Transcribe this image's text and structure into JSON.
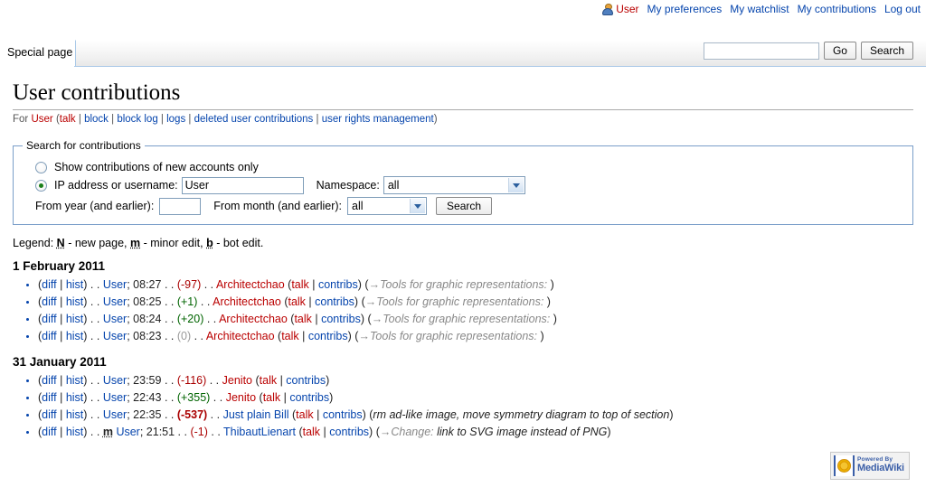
{
  "personal_bar": {
    "user_icon": "user-avatar-icon",
    "items": [
      {
        "label": "User",
        "style": "red"
      },
      {
        "label": "My preferences",
        "style": "blue"
      },
      {
        "label": "My watchlist",
        "style": "blue"
      },
      {
        "label": "My contributions",
        "style": "blue"
      },
      {
        "label": "Log out",
        "style": "blue"
      }
    ]
  },
  "tabs": {
    "special_page": "Special page"
  },
  "top_search": {
    "value": "",
    "go_label": "Go",
    "search_label": "Search"
  },
  "page": {
    "title": "User contributions",
    "subtitle": {
      "for_text": "For",
      "user": "User",
      "open_paren": "(",
      "links": [
        "talk",
        "block",
        "block log",
        "logs",
        "deleted user contributions",
        "user rights management"
      ],
      "close_paren": ")",
      "separator": " | "
    }
  },
  "search_form": {
    "legend": "Search for contributions",
    "new_accounts_label": "Show contributions of new accounts only",
    "new_accounts_checked": false,
    "ip_username_label": "IP address or username:",
    "ip_username_checked": true,
    "username_value": "User",
    "namespace_label": "Namespace:",
    "namespace_value": "all",
    "from_year_label": "From year (and earlier):",
    "from_year_value": "",
    "from_month_label": "From month (and earlier):",
    "from_month_value": "all",
    "search_button": "Search"
  },
  "legend": {
    "prefix": "Legend:",
    "new_page_flag": "N",
    "new_page_text": "- new page,",
    "minor_flag": "m",
    "minor_text": "- minor edit,",
    "bot_flag": "b",
    "bot_text": "- bot edit."
  },
  "groups": [
    {
      "date": "1 February 2011",
      "entries": [
        {
          "diff": "diff",
          "hist": "hist",
          "page": "User",
          "page_style": "blue",
          "time": "08:27",
          "delta": "(-97)",
          "delta_type": "neg",
          "delta_bold": false,
          "user": "Architectchao",
          "user_style": "red",
          "talk": "talk",
          "talk_style": "red",
          "contribs": "contribs",
          "contribs_style": "blue",
          "autocomment": "→Tools for graphic representations:",
          "comment": ""
        },
        {
          "diff": "diff",
          "hist": "hist",
          "page": "User",
          "page_style": "blue",
          "time": "08:25",
          "delta": "(+1)",
          "delta_type": "pos",
          "delta_bold": false,
          "user": "Architectchao",
          "user_style": "red",
          "talk": "talk",
          "talk_style": "red",
          "contribs": "contribs",
          "contribs_style": "blue",
          "autocomment": "→Tools for graphic representations:",
          "comment": ""
        },
        {
          "diff": "diff",
          "hist": "hist",
          "page": "User",
          "page_style": "blue",
          "time": "08:24",
          "delta": "(+20)",
          "delta_type": "pos",
          "delta_bold": false,
          "user": "Architectchao",
          "user_style": "red",
          "talk": "talk",
          "talk_style": "red",
          "contribs": "contribs",
          "contribs_style": "blue",
          "autocomment": "→Tools for graphic representations:",
          "comment": ""
        },
        {
          "diff": "diff",
          "hist": "hist",
          "page": "User",
          "page_style": "blue",
          "time": "08:23",
          "delta": "(0)",
          "delta_type": "zero",
          "delta_bold": false,
          "user": "Architectchao",
          "user_style": "red",
          "talk": "talk",
          "talk_style": "red",
          "contribs": "contribs",
          "contribs_style": "blue",
          "autocomment": "→Tools for graphic representations:",
          "comment": ""
        }
      ]
    },
    {
      "date": "31 January 2011",
      "entries": [
        {
          "diff": "diff",
          "hist": "hist",
          "page": "User",
          "page_style": "blue",
          "time": "23:59",
          "delta": "(-116)",
          "delta_type": "neg",
          "delta_bold": false,
          "user": "Jenito",
          "user_style": "red",
          "talk": "talk",
          "talk_style": "red",
          "contribs": "contribs",
          "contribs_style": "blue",
          "autocomment": "",
          "comment": ""
        },
        {
          "diff": "diff",
          "hist": "hist",
          "page": "User",
          "page_style": "blue",
          "time": "22:43",
          "delta": "(+355)",
          "delta_type": "pos",
          "delta_bold": false,
          "user": "Jenito",
          "user_style": "red",
          "talk": "talk",
          "talk_style": "red",
          "contribs": "contribs",
          "contribs_style": "blue",
          "autocomment": "",
          "comment": ""
        },
        {
          "diff": "diff",
          "hist": "hist",
          "page": "User",
          "page_style": "blue",
          "time": "22:35",
          "delta": "(-537)",
          "delta_type": "neg",
          "delta_bold": true,
          "user": "Just plain Bill",
          "user_style": "blue",
          "talk": "talk",
          "talk_style": "red",
          "contribs": "contribs",
          "contribs_style": "blue",
          "autocomment": "",
          "comment": "rm ad-like image, move symmetry diagram to top of section"
        },
        {
          "diff": "diff",
          "hist": "hist",
          "page": "User",
          "page_style": "blue",
          "minor": "m",
          "time": "21:51",
          "delta": "(-1)",
          "delta_type": "neg",
          "delta_bold": false,
          "user": "ThibautLienart",
          "user_style": "blue",
          "talk": "talk",
          "talk_style": "red",
          "contribs": "contribs",
          "contribs_style": "blue",
          "autocomment": "→Change:",
          "comment": "link to SVG image instead of PNG"
        }
      ]
    }
  ],
  "footer": {
    "powered_by_line1": "Powered By",
    "powered_by_line2": "MediaWiki"
  }
}
